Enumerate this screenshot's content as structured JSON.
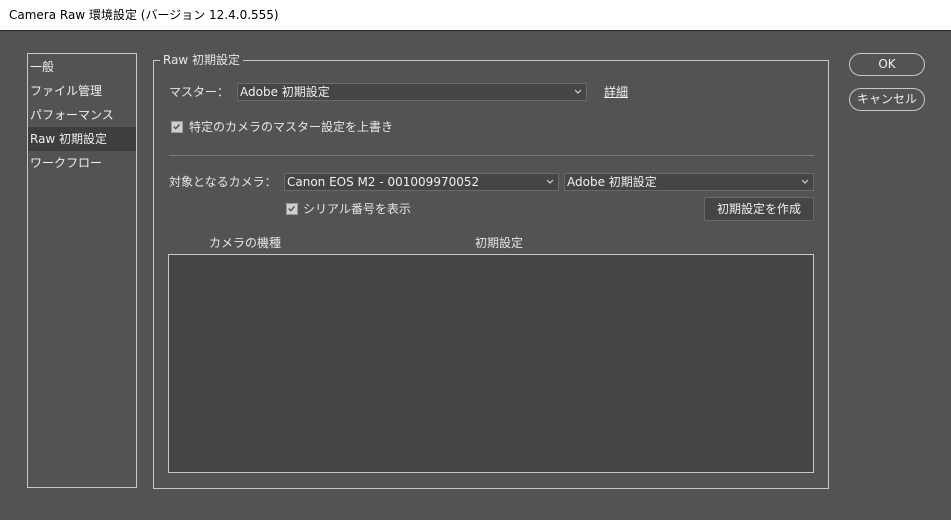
{
  "window": {
    "title": "Camera Raw 環境設定 (バージョン 12.4.0.555)"
  },
  "sidebar": {
    "items": [
      {
        "label": "一般",
        "selected": false
      },
      {
        "label": "ファイル管理",
        "selected": false
      },
      {
        "label": "パフォーマンス",
        "selected": false
      },
      {
        "label": "Raw 初期設定",
        "selected": true
      },
      {
        "label": "ワークフロー",
        "selected": false
      }
    ]
  },
  "raw_defaults": {
    "group_title": "Raw 初期設定",
    "master_label": "マスター：",
    "master_value": "Adobe 初期設定",
    "details_link": "詳細",
    "override_checkbox_label": "特定のカメラのマスター設定を上書き",
    "override_checked": true,
    "target_camera_label": "対象となるカメラ：",
    "camera_value": "Canon EOS M2 - 001009970052",
    "camera_default_value": "Adobe 初期設定",
    "show_serial_label": "シリアル番号を表示",
    "show_serial_checked": true,
    "create_default_button": "初期設定を作成",
    "table_headers": {
      "camera_model": "カメラの機種",
      "default": "初期設定"
    }
  },
  "buttons": {
    "ok": "OK",
    "cancel": "キャンセル"
  }
}
